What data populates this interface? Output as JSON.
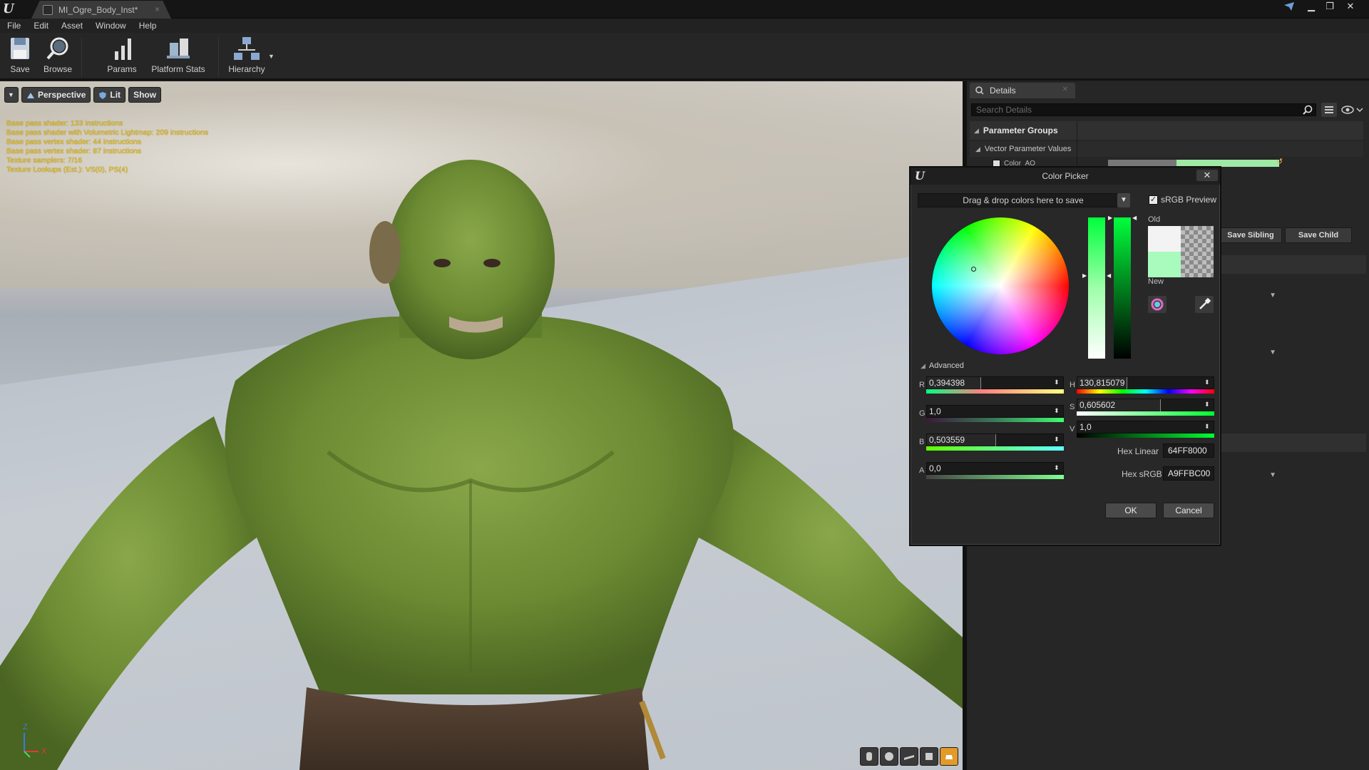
{
  "window": {
    "tab_title": "MI_Ogre_Body_Inst*",
    "tab_close": "×",
    "controls": {
      "minimize": "▁",
      "restore": "❐",
      "close": "✕"
    }
  },
  "menu": [
    "File",
    "Edit",
    "Asset",
    "Window",
    "Help"
  ],
  "toolbar": {
    "save": "Save",
    "browse": "Browse",
    "params": "Params",
    "platform_stats": "Platform Stats",
    "hierarchy": "Hierarchy"
  },
  "viewport": {
    "perspective": "Perspective",
    "lit": "Lit",
    "show": "Show",
    "stats": [
      "Base pass shader: 133 instructions",
      "Base pass shader with Volumetric Lightmap: 209 instructions",
      "Base pass vertex shader: 44 instructions",
      "Base pass vertex shader: 87 instructions",
      "Texture samplers: 7/16",
      "Texture Lookups (Est.): VS(0), PS(4)"
    ],
    "axis": {
      "z": "Z",
      "x": "X"
    },
    "stats_color": "#f2c400"
  },
  "details": {
    "tab_label": "Details",
    "search_placeholder": "Search Details",
    "parameter_groups": "Parameter Groups",
    "vector_parameter_values": "Vector Parameter Values",
    "color_ao": "Color_AO",
    "save_sibling": "Save Sibling",
    "save_child": "Save Child"
  },
  "color_picker": {
    "title": "Color Picker",
    "close": "✕",
    "dropzone": "Drag & drop colors here to save",
    "srgb_preview": "sRGB Preview",
    "srgb_checked": "✓",
    "old_label": "Old",
    "new_label": "New",
    "advanced": "Advanced",
    "channels": {
      "r": {
        "label": "R",
        "value": "0,394398"
      },
      "g": {
        "label": "G",
        "value": "1,0"
      },
      "b": {
        "label": "B",
        "value": "0,503559"
      },
      "a": {
        "label": "A",
        "value": "0,0"
      },
      "h": {
        "label": "H",
        "value": "130,815079"
      },
      "s": {
        "label": "S",
        "value": "0,605602"
      },
      "v": {
        "label": "V",
        "value": "1,0"
      }
    },
    "hex_linear_label": "Hex Linear",
    "hex_linear": "64FF8000",
    "hex_srgb_label": "Hex sRGB",
    "hex_srgb": "A9FFBC00",
    "ok": "OK",
    "cancel": "Cancel",
    "old_color": "#f3f3f3",
    "new_color": "#a8fbbd"
  },
  "accent": "#e29a2a"
}
